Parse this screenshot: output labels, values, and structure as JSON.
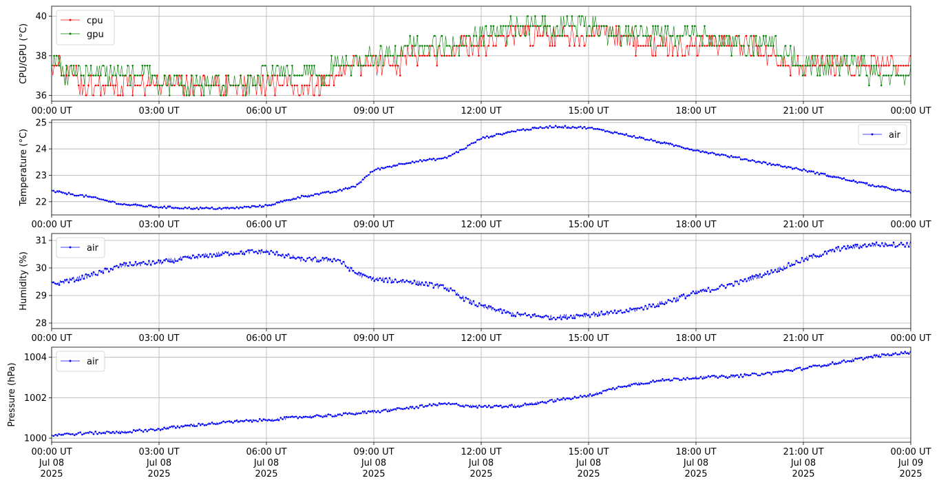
{
  "chart_data": [
    {
      "type": "line",
      "ylabel": "CPU/GPU (°C)",
      "ylim": [
        35.7,
        40.5
      ],
      "yticks": [
        36,
        38,
        40
      ],
      "legend": "top-left",
      "grid": true,
      "xlim": [
        0,
        24
      ],
      "x_tick_labels": [
        "00:00 UT",
        "03:00 UT",
        "06:00 UT",
        "09:00 UT",
        "12:00 UT",
        "15:00 UT",
        "18:00 UT",
        "21:00 UT",
        "00:00 UT"
      ],
      "series": [
        {
          "name": "cpu",
          "color": "#ff0000",
          "x": [
            0,
            0.5,
            1,
            1.5,
            2,
            2.5,
            3,
            3.5,
            4,
            4.5,
            5,
            5.5,
            6,
            6.5,
            7,
            7.5,
            8,
            8.5,
            9,
            9.5,
            10,
            10.5,
            11,
            11.5,
            12,
            12.5,
            13,
            13.5,
            14,
            14.5,
            15,
            15.5,
            16,
            16.5,
            17,
            17.5,
            18,
            18.5,
            19,
            19.5,
            20,
            20.5,
            21,
            21.5,
            22,
            22.5,
            23,
            23.5,
            24
          ],
          "values": [
            37.5,
            37.0,
            36.5,
            36.5,
            36.5,
            36.5,
            36.5,
            36.5,
            36.5,
            36.5,
            36.5,
            36.5,
            36.5,
            36.5,
            36.5,
            36.5,
            37.0,
            37.5,
            37.5,
            37.5,
            38.0,
            38.0,
            38.0,
            38.5,
            38.5,
            38.5,
            39.0,
            39.0,
            39.0,
            39.0,
            39.0,
            39.0,
            39.0,
            38.5,
            38.5,
            38.5,
            38.5,
            38.5,
            38.5,
            38.5,
            38.0,
            37.5,
            37.5,
            37.5,
            37.5,
            37.5,
            37.5,
            37.5,
            37.5
          ]
        },
        {
          "name": "gpu",
          "color": "#008000",
          "x": [
            0,
            0.5,
            1,
            1.5,
            2,
            2.5,
            3,
            3.5,
            4,
            4.5,
            5,
            5.5,
            6,
            6.5,
            7,
            7.5,
            8,
            8.5,
            9,
            9.5,
            10,
            10.5,
            11,
            11.5,
            12,
            12.5,
            13,
            13.5,
            14,
            14.5,
            15,
            15.5,
            16,
            16.5,
            17,
            17.5,
            18,
            18.5,
            19,
            19.5,
            20,
            20.5,
            21,
            21.5,
            22,
            22.5,
            23,
            23.5,
            24
          ],
          "values": [
            37.5,
            37.0,
            37.0,
            37.0,
            37.0,
            37.0,
            36.5,
            36.5,
            36.5,
            36.5,
            36.5,
            36.5,
            37.0,
            37.0,
            37.0,
            37.0,
            37.5,
            37.5,
            38.0,
            38.0,
            38.5,
            38.5,
            38.5,
            38.5,
            39.0,
            39.0,
            39.5,
            39.5,
            39.5,
            39.5,
            39.5,
            39.0,
            39.0,
            39.0,
            39.0,
            39.0,
            39.0,
            38.5,
            38.5,
            38.5,
            38.5,
            38.0,
            37.5,
            37.5,
            37.5,
            37.5,
            37.0,
            37.0,
            37.0
          ]
        }
      ]
    },
    {
      "type": "line",
      "ylabel": "Temperature (°C)",
      "ylim": [
        21.5,
        25.1
      ],
      "yticks": [
        22,
        23,
        24,
        25
      ],
      "legend": "top-right",
      "grid": true,
      "xlim": [
        0,
        24
      ],
      "x_tick_labels": [
        "00:00 UT",
        "03:00 UT",
        "06:00 UT",
        "09:00 UT",
        "12:00 UT",
        "15:00 UT",
        "18:00 UT",
        "21:00 UT",
        "00:00 UT"
      ],
      "series": [
        {
          "name": "air",
          "color": "#0000ff",
          "x": [
            0,
            1,
            2,
            3,
            4,
            5,
            6,
            7,
            8,
            8.5,
            9,
            10,
            11,
            11.5,
            12,
            13,
            14,
            15,
            16,
            17,
            18,
            19,
            20,
            21,
            22,
            23,
            24
          ],
          "values": [
            22.4,
            22.2,
            21.9,
            21.8,
            21.75,
            21.75,
            21.85,
            22.2,
            22.4,
            22.6,
            23.2,
            23.5,
            23.65,
            24.0,
            24.4,
            24.7,
            24.85,
            24.8,
            24.55,
            24.25,
            23.95,
            23.7,
            23.45,
            23.2,
            22.9,
            22.6,
            22.35
          ]
        }
      ]
    },
    {
      "type": "line",
      "ylabel": "Humidity (%)",
      "ylim": [
        27.8,
        31.25
      ],
      "yticks": [
        28,
        29,
        30,
        31
      ],
      "legend": "top-left",
      "grid": true,
      "xlim": [
        0,
        24
      ],
      "x_tick_labels": [
        "00:00 UT",
        "03:00 UT",
        "06:00 UT",
        "09:00 UT",
        "12:00 UT",
        "15:00 UT",
        "18:00 UT",
        "21:00 UT",
        "00:00 UT"
      ],
      "series": [
        {
          "name": "air",
          "color": "#0000ff",
          "x": [
            0,
            1,
            2,
            3,
            4,
            5,
            6,
            7,
            8,
            8.5,
            9,
            10,
            11,
            11.5,
            12,
            13,
            14,
            15,
            16,
            17,
            18,
            19,
            20,
            21,
            22,
            23,
            24
          ],
          "values": [
            29.4,
            29.7,
            30.1,
            30.2,
            30.4,
            30.55,
            30.6,
            30.3,
            30.3,
            29.8,
            29.6,
            29.5,
            29.3,
            28.9,
            28.6,
            28.3,
            28.2,
            28.3,
            28.4,
            28.7,
            29.1,
            29.4,
            29.8,
            30.3,
            30.7,
            30.85,
            30.85
          ]
        }
      ]
    },
    {
      "type": "line",
      "ylabel": "Pressure (hPa)",
      "ylim": [
        999.8,
        1004.5
      ],
      "yticks": [
        1000,
        1002,
        1004
      ],
      "legend": "top-left",
      "grid": true,
      "xlim": [
        0,
        24
      ],
      "x_tick_labels": [
        "00:00 UT\nJul 08\n2025",
        "03:00 UT\nJul 08\n2025",
        "06:00 UT\nJul 08\n2025",
        "09:00 UT\nJul 08\n2025",
        "12:00 UT\nJul 08\n2025",
        "15:00 UT\nJul 08\n2025",
        "18:00 UT\nJul 08\n2025",
        "21:00 UT\nJul 08\n2025",
        "00:00 UT\nJul 09\n2025"
      ],
      "series": [
        {
          "name": "air",
          "color": "#0000ff",
          "x": [
            0,
            1,
            2,
            3,
            4,
            5,
            6,
            7,
            8,
            9,
            10,
            11,
            12,
            13,
            14,
            15,
            16,
            17,
            18,
            19,
            20,
            21,
            22,
            23,
            24
          ],
          "values": [
            1000.15,
            1000.25,
            1000.3,
            1000.45,
            1000.65,
            1000.8,
            1000.9,
            1001.05,
            1001.15,
            1001.3,
            1001.5,
            1001.7,
            1001.55,
            1001.6,
            1001.85,
            1002.1,
            1002.6,
            1002.85,
            1003.0,
            1003.05,
            1003.2,
            1003.45,
            1003.75,
            1004.05,
            1004.25
          ]
        }
      ]
    }
  ]
}
